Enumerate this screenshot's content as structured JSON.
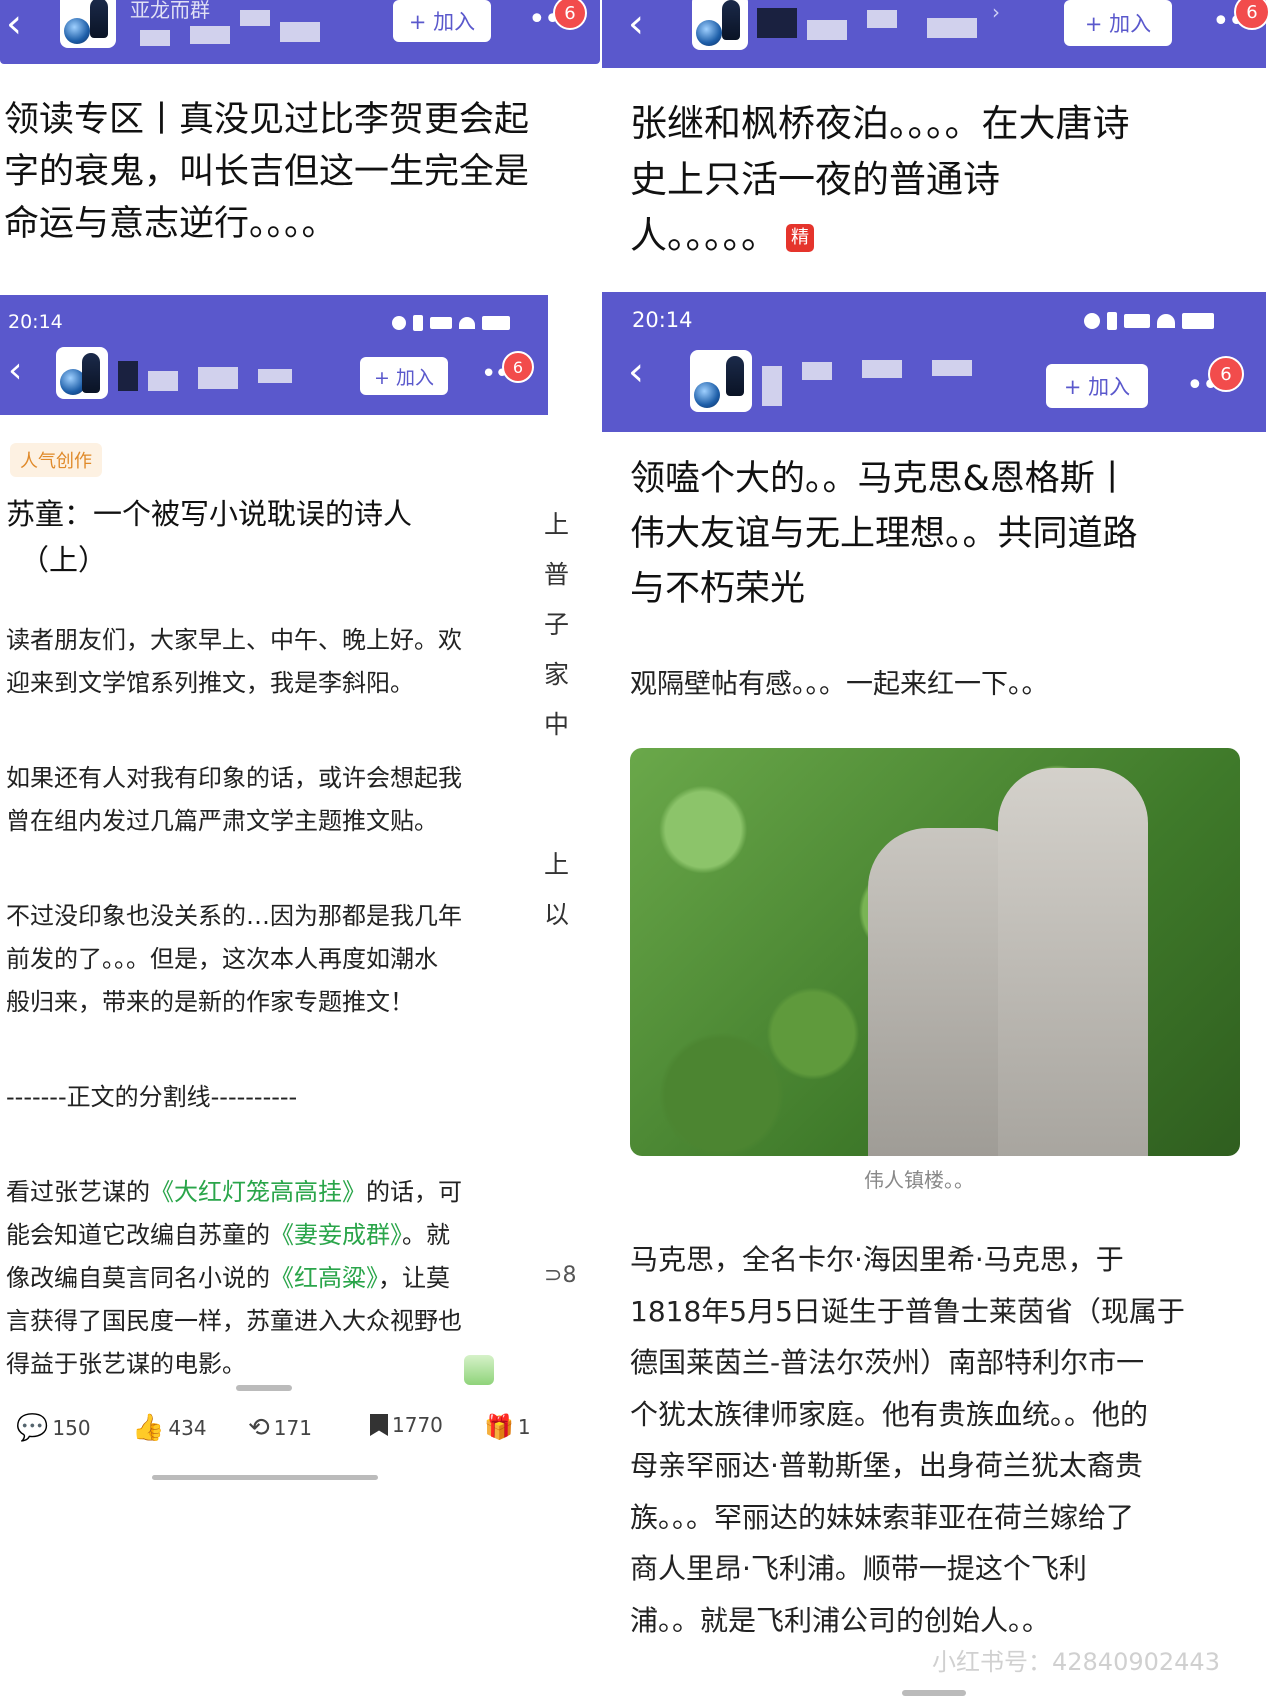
{
  "common": {
    "time": "20:14",
    "join_label": "+ 加入",
    "badge_count": "6",
    "battery": "5",
    "network": "5G HD"
  },
  "top_left": {
    "group_name_partial": "亚龙而群",
    "title_lines": [
      "领读专区丨真没见过比李贺更会起",
      "字的衰鬼，叫长吉但这一生完全是",
      "命运与意志逆行。。。。"
    ]
  },
  "top_right": {
    "title_lines": [
      "张继和枫桥夜泊。。。。在大唐诗",
      "史上只活一夜的普通诗",
      "人。。。。。"
    ],
    "jing_badge": "精"
  },
  "left_post": {
    "tag": "人气创作",
    "title_lines": [
      "苏童：一个被写小说耽误的诗人",
      "（上）"
    ],
    "para1": [
      "读者朋友们，大家早上、中午、晚上好。欢",
      "迎来到文学馆系列推文，我是李斜阳。"
    ],
    "para2": [
      "如果还有人对我有印象的话，或许会想起我",
      "曾在组内发过几篇严肃文学主题推文贴。"
    ],
    "para3": [
      "不过没印象也没关系的…因为那都是我几年",
      "前发的了。。。但是，这次本人再度如潮水",
      "般归来，带来的是新的作家专题推文！"
    ],
    "divider": "-------正文的分割线----------",
    "para4_a": "看过张艺谋的",
    "link1": "《大红灯笼高高挂》",
    "para4_b": "的话，可",
    "para4_c": "能会知道它改编自苏童的",
    "link2": "《妻妾成群》",
    "para4_d": "。就",
    "para4_e": "像改编自莫言同名小说的",
    "link3": "《红高粱》",
    "para4_f": "，让莫",
    "para4_g": "言获得了国民度一样，苏童进入大众视野也",
    "para4_h": "得益于张艺谋的电影。",
    "side_chars": [
      "上",
      "普",
      "子",
      "家",
      "中",
      "上",
      "以"
    ],
    "side_count": "8",
    "actions": {
      "comments": "150",
      "likes": "434",
      "reposts": "171",
      "favorites": "1770",
      "gifts": "1"
    }
  },
  "right_post": {
    "title_lines": [
      "领嗑个大的。。马克思&恩格斯丨",
      "伟大友谊与无上理想。。共同道路",
      "与不朽荣光"
    ],
    "intro": "观隔壁帖有感。。。一起来红一下。。",
    "image_caption": "伟人镇楼。。",
    "body_lines": [
      "马克思，全名卡尔·海因里希·马克思，于",
      "1818年5月5日诞生于普鲁士莱茵省（现属于",
      "德国莱茵兰-普法尔茨州）南部特利尔市一",
      "个犹太族律师家庭。他有贵族血统。。他的",
      "母亲罕丽达·普勒斯堡，出身荷兰犹太裔贵",
      "族。。。罕丽达的妹妹索菲亚在荷兰嫁给了",
      "商人里昂·飞利浦。顺带一提这个飞利",
      "浦。。就是飞利浦公司的创始人。。"
    ],
    "watermark": "小红书号：42840902443"
  }
}
